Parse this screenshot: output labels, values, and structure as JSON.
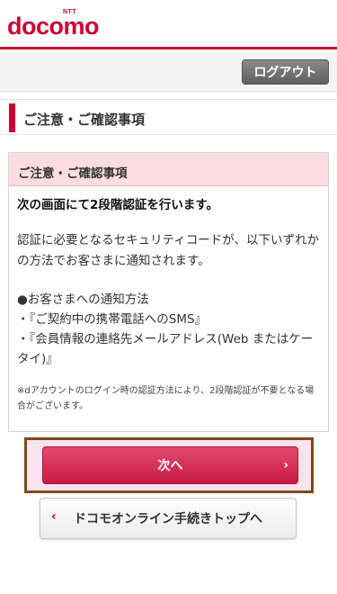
{
  "header": {
    "logo_small": "NTT",
    "logo_text": "docomo",
    "brand_color": "#cc0033"
  },
  "toolbar": {
    "logout_label": "ログアウト"
  },
  "page": {
    "title": "ご注意・ご確認事項"
  },
  "notice": {
    "heading": "ご注意・ご確認事項",
    "lead": "次の画面にて2段階認証を行います。",
    "paragraph": "認証に必要となるセキュリティコードが、以下いずれかの方法でお客さまに通知されます。",
    "methods_title": "●お客さまへの通知方法",
    "methods": [
      "・『ご契約中の携帯電話へのSMS』",
      "・『会員情報の連絡先メールアドレス(Web またはケータイ)』"
    ],
    "footnote": "※dアカウントのログイン時の認証方法により、2段階認証が不要となる場合がございます。"
  },
  "actions": {
    "next_label": "次へ",
    "next_icon": "chevron-right-icon",
    "back_label": "ドコモオンライン手続きトップへ",
    "back_icon": "chevron-left-icon",
    "accent_color": "#cc1a45"
  }
}
